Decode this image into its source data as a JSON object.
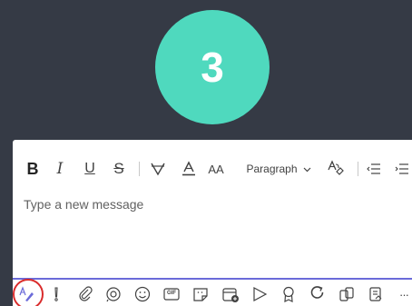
{
  "step": {
    "number": "3",
    "color": "#4fd9be"
  },
  "composer": {
    "placeholder": "Type a new message",
    "accent_color": "#6b6bd9",
    "highlight_color": "#d92c2c"
  },
  "format_bar": {
    "bold_label": "B",
    "italic_label": "I",
    "underline_label": "U",
    "strike_label": "S",
    "font_size_label": "AA",
    "paragraph_label": "Paragraph",
    "items": [
      "bold",
      "italic",
      "underline",
      "strikethrough",
      "highlight",
      "font-color",
      "font-size",
      "paragraph-style",
      "clear-formatting",
      "decrease-indent",
      "increase-indent"
    ]
  },
  "action_bar": {
    "icons": [
      "format-icon",
      "important-icon",
      "attach-icon",
      "loop-icon",
      "emoji-icon",
      "gif-icon",
      "sticker-icon",
      "schedule-meeting-icon",
      "stream-icon",
      "praise-icon",
      "update-icon",
      "apps-icon",
      "approvals-icon",
      "more-icon"
    ],
    "gif_label": "GIF",
    "more_label": "···"
  }
}
